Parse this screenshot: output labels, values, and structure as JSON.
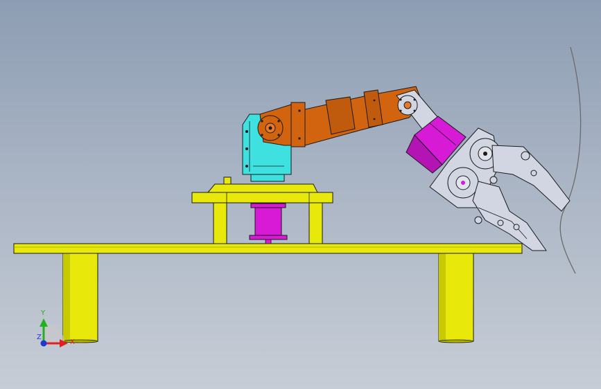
{
  "viewport": {
    "colors": {
      "background_top": "#8d9db3",
      "background_bottom": "#c7cdd6",
      "base_yellow": "#e8e80a",
      "base_yellow_dark": "#b5b500",
      "servo_cyan": "#3fe0e0",
      "arm_orange": "#d2640f",
      "motor_magenta": "#d61ad6",
      "gripper_gray": "#d2d6e2",
      "outline": "#1a1a1a"
    }
  },
  "model": {
    "parts": [
      "base-table",
      "table-leg-left",
      "table-leg-right",
      "turntable-platform",
      "base-motor",
      "shoulder-servo",
      "upper-arm",
      "elbow-joint",
      "wrist-motor",
      "gripper"
    ]
  },
  "triad": {
    "x_label": "X",
    "y_label": "Y",
    "z_label": "Z",
    "icons": [
      "x-axis-arrow-icon",
      "y-axis-arrow-icon",
      "z-axis-dot-icon"
    ],
    "colors": {
      "x": "#e02020",
      "y": "#20b020",
      "z": "#1a3ad6"
    }
  }
}
